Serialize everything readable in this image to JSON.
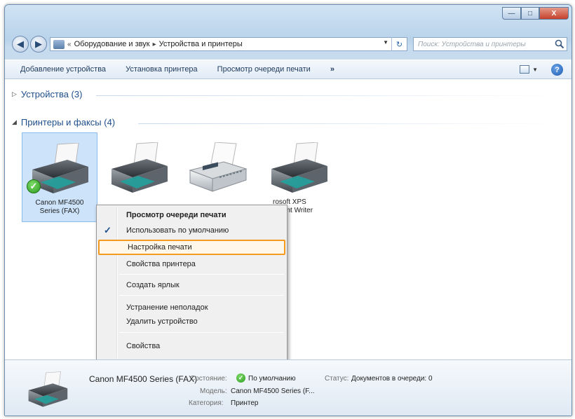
{
  "window": {
    "caption_buttons": {
      "minimize": "—",
      "maximize": "□",
      "close": "X"
    }
  },
  "nav": {
    "back_glyph": "◀",
    "forward_glyph": "▶"
  },
  "address_bar": {
    "separator_lead": "«",
    "crumbs": [
      "Оборудование и звук",
      "Устройства и принтеры"
    ],
    "crumb_separator": "▸",
    "dropdown_glyph": "▼",
    "refresh_glyph": "↻"
  },
  "search": {
    "placeholder": "Поиск: Устройства и принтеры"
  },
  "toolbar": {
    "items": [
      "Добавление устройства",
      "Установка принтера",
      "Просмотр очереди печати"
    ],
    "more": "»",
    "views_dropdown": "▼",
    "help": "?"
  },
  "groups": {
    "devices": {
      "arrow": "▷",
      "label": "Устройства (3)"
    },
    "printers": {
      "arrow": "◢",
      "label": "Принтеры и факсы (4)"
    }
  },
  "printers": [
    {
      "label_line1": "Canon MF4500",
      "label_line2": "Series (FAX)",
      "icon": "printer-icon",
      "selected": true,
      "default": true
    },
    {
      "label_line1": "",
      "label_line2": "",
      "icon": "printer-icon",
      "selected": false,
      "default": false
    },
    {
      "label_line1": "",
      "label_line2": "",
      "icon": "fax-icon",
      "selected": false,
      "default": false
    },
    {
      "label_line1": "rosoft XPS",
      "label_line2": "ument Writer",
      "icon": "printer-icon",
      "selected": false,
      "default": false
    }
  ],
  "default_check_glyph": "✓",
  "context_menu": {
    "items": [
      {
        "label": "Просмотр очереди печати",
        "bold": true,
        "checked": false,
        "highlighted": false
      },
      {
        "label": "Использовать по умолчанию",
        "bold": false,
        "checked": true,
        "highlighted": false
      },
      {
        "label": "Настройка печати",
        "bold": false,
        "checked": false,
        "highlighted": true
      },
      {
        "label": "Свойства принтера",
        "bold": false,
        "checked": false,
        "highlighted": false
      },
      {
        "label": "Создать ярлык",
        "bold": false,
        "checked": false,
        "highlighted": false
      },
      {
        "label": "Устранение неполадок",
        "bold": false,
        "checked": false,
        "highlighted": false
      },
      {
        "label": "Удалить устройство",
        "bold": false,
        "checked": false,
        "highlighted": false
      },
      {
        "label": "Свойства",
        "bold": false,
        "checked": false,
        "highlighted": false
      }
    ],
    "check_glyph": "✓",
    "highlight_color": "#f39a1f"
  },
  "details": {
    "name": "Canon MF4500 Series (FAX)",
    "state_label": "Состояние:",
    "state_value": "По умолчанию",
    "status_label": "Статус:",
    "status_value": "Документов в очереди: 0",
    "model_label": "Модель:",
    "model_value": "Canon MF4500 Series (F...",
    "category_label": "Категория:",
    "category_value": "Принтер",
    "state_icon_glyph": "✓"
  },
  "colors": {
    "accent": "#1f4f8c",
    "selection": "#cce3fa",
    "ok_green": "#2d9a20"
  }
}
